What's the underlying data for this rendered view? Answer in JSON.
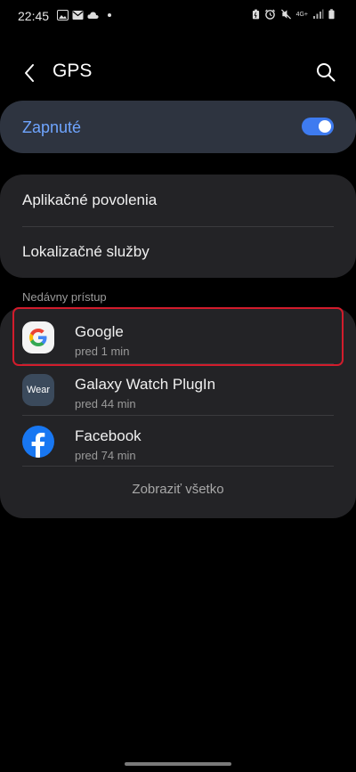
{
  "status_bar": {
    "time": "22:45",
    "left_icons": [
      "image-icon",
      "gmail-icon",
      "cloud-icon",
      "notification-dot"
    ],
    "right_icons": [
      "battery-saver-icon",
      "alarm-icon",
      "mute-icon",
      "network-type",
      "signal-icon",
      "battery-icon"
    ],
    "network_type": "4G+"
  },
  "header": {
    "title": "GPS",
    "back_icon": "back-arrow-icon",
    "search_icon": "search-icon"
  },
  "master_switch": {
    "label": "Zapnuté",
    "enabled": true,
    "accent": "#3e7bf0"
  },
  "settings": [
    {
      "label": "Aplikačné povolenia"
    },
    {
      "label": "Lokalizačné služby"
    }
  ],
  "recent_access": {
    "section_label": "Nedávny prístup",
    "apps": [
      {
        "name": "Google",
        "time": "pred 1 min",
        "icon": "google-icon"
      },
      {
        "name": "Galaxy Watch PlugIn",
        "time": "pred 44 min",
        "icon": "wear-icon",
        "icon_text": "Wear"
      },
      {
        "name": "Facebook",
        "time": "pred 74 min",
        "icon": "facebook-icon"
      }
    ],
    "show_all_label": "Zobraziť všetko"
  },
  "colors": {
    "highlight": "#d21c2c",
    "card": "#232326",
    "master_card": "#2e3440"
  }
}
